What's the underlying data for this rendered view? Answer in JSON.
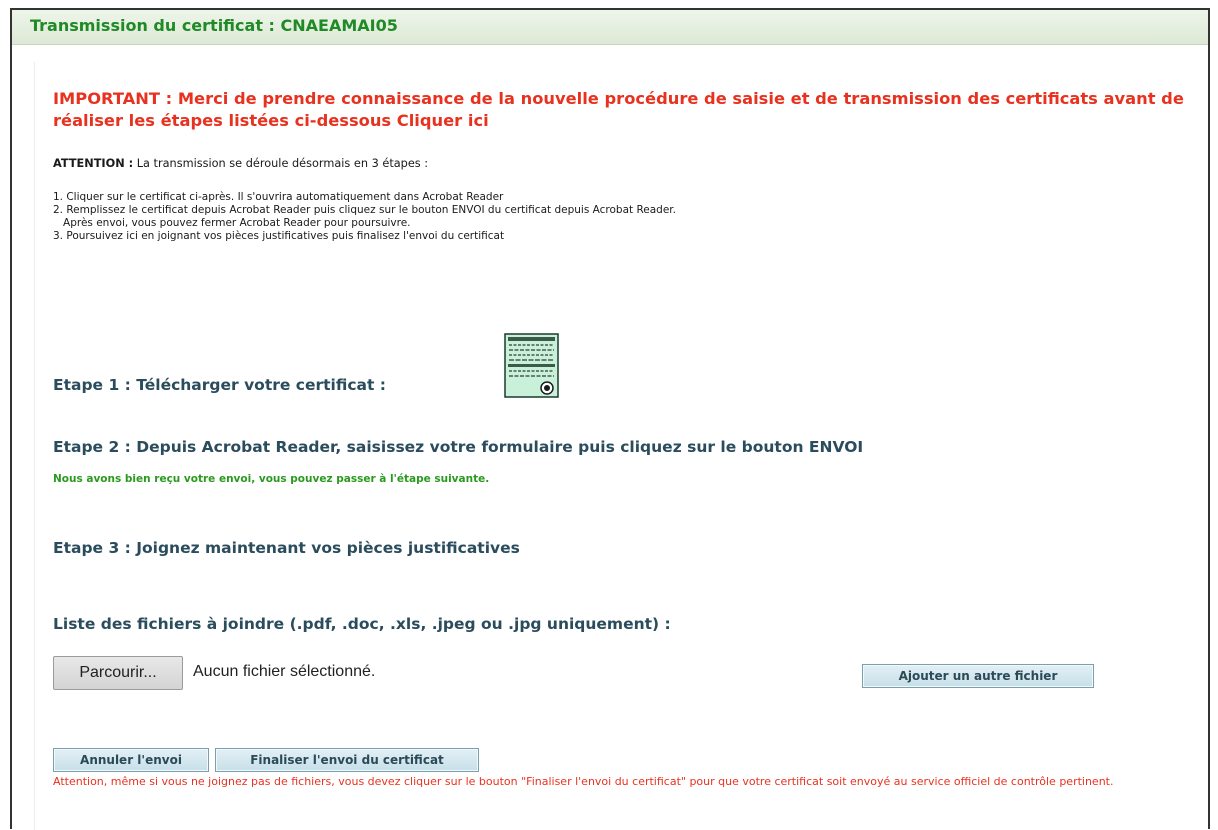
{
  "header": {
    "title": "Transmission du certificat : CNAEAMAI05"
  },
  "important_notice": "IMPORTANT : Merci de prendre connaissance de la nouvelle procédure de saisie et de transmission des certificats avant de réaliser les étapes listées ci-dessous Cliquer ici",
  "attention": {
    "label": "ATTENTION :",
    "text": " La transmission se déroule désormais en 3 étapes :"
  },
  "steps": [
    "1. Cliquer sur le certificat ci-après. Il s'ouvrira automatiquement dans Acrobat Reader",
    "2. Remplissez le certificat depuis Acrobat Reader puis cliquez sur le bouton ENVOI du certificat depuis Acrobat Reader.",
    "   Après envoi, vous pouvez fermer Acrobat Reader pour poursuivre.",
    "3. Poursuivez ici en joignant vos pièces justificatives puis finalisez l'envoi du certificat"
  ],
  "etape1": "Etape 1 : Télécharger votre certificat :",
  "etape2": "Etape 2 : Depuis Acrobat Reader, saisissez votre formulaire puis cliquez sur le bouton ENVOI",
  "success_message": "Nous avons bien reçu votre envoi, vous pouvez passer à l'étape suivante.",
  "etape3": "Etape 3 : Joignez maintenant vos pièces justificatives",
  "file_list_label": "Liste des fichiers à joindre (.pdf, .doc, .xls, .jpeg ou .jpg uniquement) :",
  "file_input": {
    "browse_label": "Parcourir...",
    "status": "Aucun fichier sélectionné."
  },
  "buttons": {
    "add_file": "Ajouter un autre fichier",
    "cancel": "Annuler l'envoi",
    "finalize": "Finaliser l'envoi du certificat"
  },
  "warning": "Attention, même si vous ne joignez pas de fichiers, vous devez cliquer sur le bouton \"Finaliser l'envoi du certificat\" pour que votre certificat soit envoyé au service officiel de contrôle pertinent.",
  "icons": {
    "certificate": "document-certificate-icon"
  },
  "colors": {
    "title_green": "#1f8a26",
    "important_red": "#e8321f",
    "heading_blue": "#2a4c5c",
    "success_green": "#2a9a1f"
  }
}
